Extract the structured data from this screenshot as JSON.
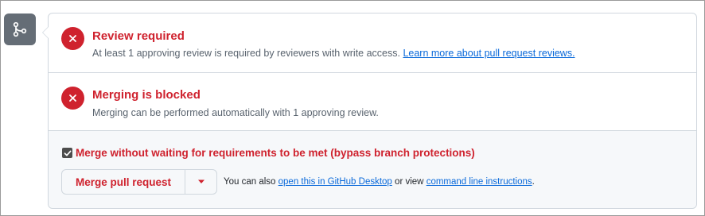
{
  "colors": {
    "error": "#cf222e",
    "link": "#0969da",
    "muted": "#59636e",
    "icon_badge": "#656d76"
  },
  "timeline_icon": "git-merge-icon",
  "review": {
    "icon": "x-circle-icon",
    "title": "Review required",
    "description": "At least 1 approving review is required by reviewers with write access.",
    "link_text": "Learn more about pull request reviews."
  },
  "blocked": {
    "icon": "x-circle-icon",
    "title": "Merging is blocked",
    "description": "Merging can be performed automatically with 1 approving review."
  },
  "merge": {
    "bypass_checked": true,
    "bypass_label": "Merge without waiting for requirements to be met (bypass branch protections)",
    "button_label": "Merge pull request",
    "dropdown_icon": "triangle-down-icon",
    "helper_prefix": "You can also",
    "desktop_link": "open this in GitHub Desktop",
    "helper_middle": "or view",
    "cli_link": "command line instructions",
    "helper_suffix": "."
  }
}
